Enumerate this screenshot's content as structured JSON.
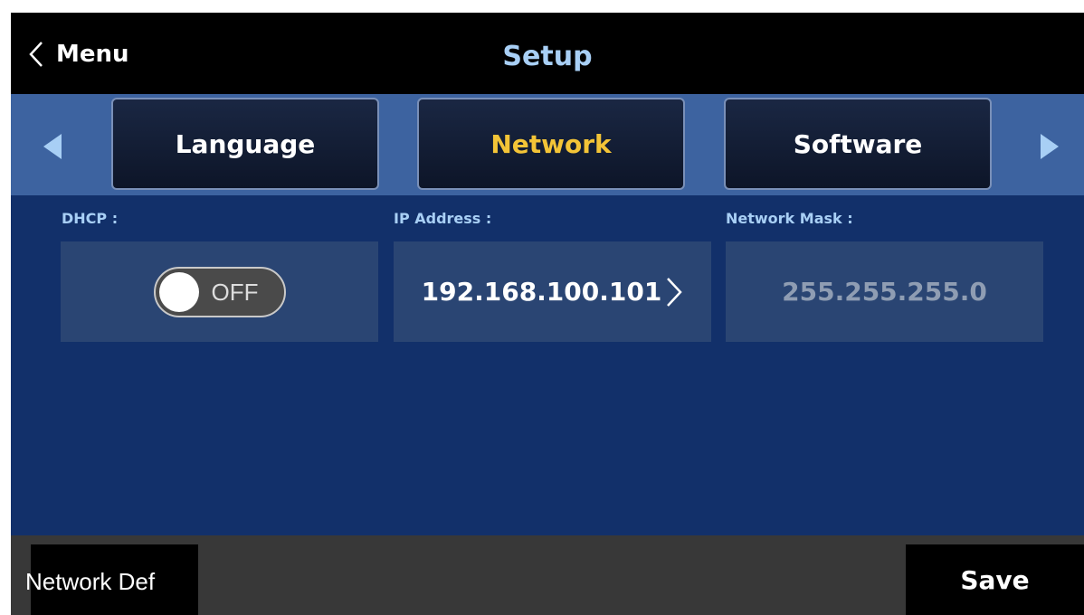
{
  "header": {
    "back_label": "Menu",
    "title": "Setup"
  },
  "tabs": [
    {
      "label": "Language",
      "active": false
    },
    {
      "label": "Network",
      "active": true
    },
    {
      "label": "Software",
      "active": false
    }
  ],
  "fields": {
    "dhcp": {
      "label": "DHCP :",
      "state": "OFF"
    },
    "ip_address": {
      "label": "IP Address :",
      "value": "192.168.100.101"
    },
    "network_mask": {
      "label": "Network Mask :",
      "value": "255.255.255.0"
    }
  },
  "footer": {
    "network_default_label": "Network Def",
    "save_label": "Save"
  },
  "colors": {
    "accent_active_tab": "#f3c437",
    "label_blue": "#a8cff5",
    "background": "#12306a"
  },
  "icons": {
    "back": "chevron-left-icon",
    "prev": "triangle-left-icon",
    "next": "triangle-right-icon",
    "ip_edit": "chevron-right-icon"
  }
}
